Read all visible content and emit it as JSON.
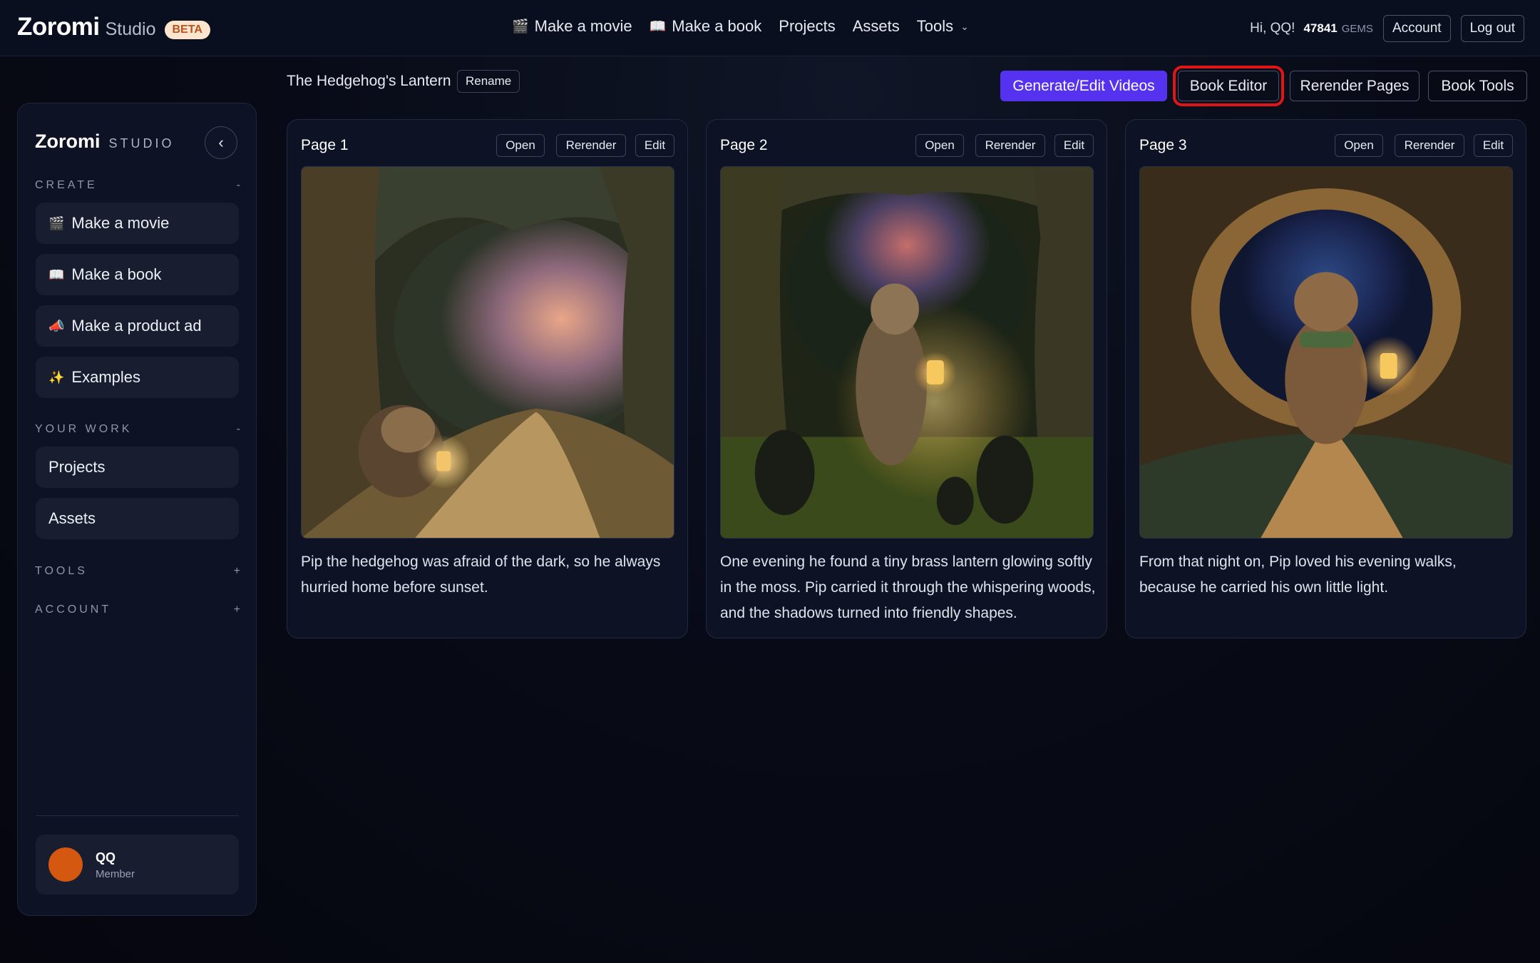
{
  "topbar": {
    "logo": "Zoromi",
    "logo_sub": "Studio",
    "beta": "BETA",
    "nav": [
      {
        "emoji": "🎬",
        "label": "Make a movie"
      },
      {
        "emoji": "📖",
        "label": "Make a book"
      },
      {
        "emoji": "",
        "label": "Projects"
      },
      {
        "emoji": "",
        "label": "Assets"
      },
      {
        "emoji": "",
        "label": "Tools"
      }
    ],
    "tools_chevron": "⌄",
    "greeting": "Hi, QQ!",
    "gems_count": "47841",
    "gems_label": "GEMS",
    "account_label": "Account",
    "logout_label": "Log out"
  },
  "sidebar": {
    "brand": "Zoromi",
    "brand_sub": "STUDIO",
    "collapse_glyph": "‹",
    "sections": {
      "create": {
        "label": "CREATE",
        "toggle": "-"
      },
      "your_work": {
        "label": "YOUR WORK",
        "toggle": "-"
      },
      "tools": {
        "label": "TOOLS",
        "toggle": "+"
      },
      "account": {
        "label": "ACCOUNT",
        "toggle": "+"
      }
    },
    "create_items": [
      {
        "emoji": "🎬",
        "label": "Make a movie"
      },
      {
        "emoji": "📖",
        "label": "Make a book"
      },
      {
        "emoji": "📣",
        "label": "Make a product ad"
      },
      {
        "emoji": "✨",
        "label": "Examples"
      }
    ],
    "work_items": [
      {
        "label": "Projects"
      },
      {
        "label": "Assets"
      }
    ],
    "user": {
      "name": "QQ",
      "role": "Member",
      "avatar_color": "#d4580f"
    }
  },
  "main": {
    "project_title": "The Hedgehog's Lantern",
    "rename_label": "Rename",
    "actions": [
      {
        "label": "Generate/Edit Videos"
      },
      {
        "label": "Book Editor"
      },
      {
        "label": "Rerender Pages"
      },
      {
        "label": "Book Tools"
      }
    ],
    "accent_color": "#5532f0",
    "highlight_color": "#e01515",
    "pages": [
      {
        "title": "Page 1",
        "open": "Open",
        "rerender": "Rerender",
        "edit": "Edit",
        "text": "Pip the hedgehog was afraid of the dark, so he always hurried home before sunset."
      },
      {
        "title": "Page 2",
        "open": "Open",
        "rerender": "Rerender",
        "edit": "Edit",
        "text": "One evening he found a tiny brass lantern glowing softly in the moss. Pip carried it through the whispering woods, and the shadows turned into friendly shapes."
      },
      {
        "title": "Page 3",
        "open": "Open",
        "rerender": "Rerender",
        "edit": "Edit",
        "text": "From that night on, Pip loved his evening walks, because he carried his own little light."
      }
    ]
  }
}
